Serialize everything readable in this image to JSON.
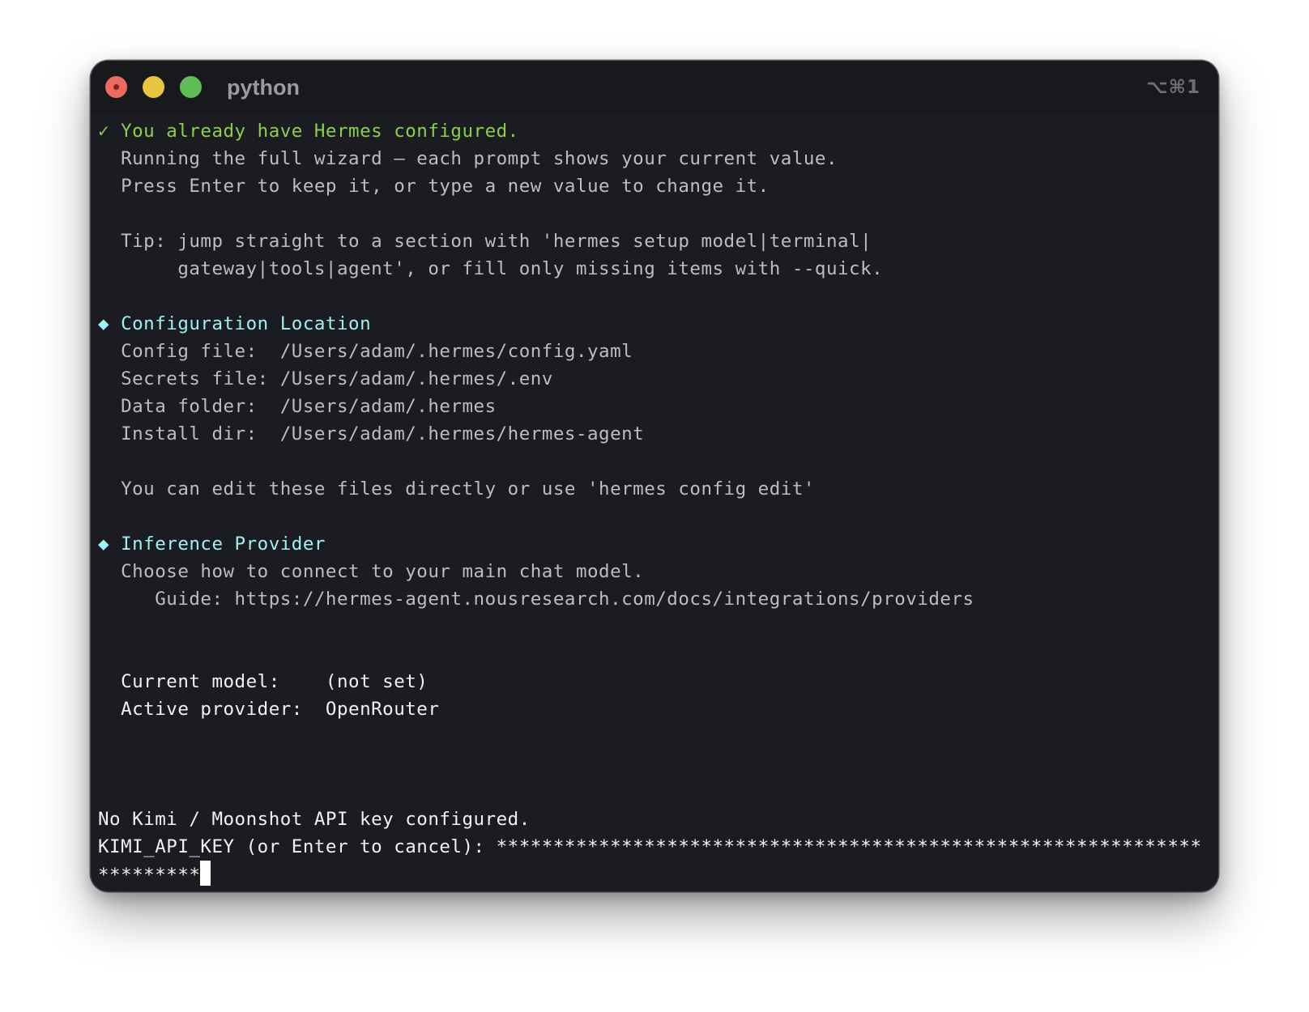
{
  "window": {
    "title": "python",
    "shortcut": "⌥⌘1"
  },
  "terminal": {
    "configured_mark": "✓",
    "configured_text": "You already have Hermes configured.",
    "wizard_line1": "Running the full wizard — each prompt shows your current value.",
    "wizard_line2": "Press Enter to keep it, or type a new value to change it.",
    "tip_line1": "Tip: jump straight to a section with 'hermes setup model|terminal|",
    "tip_line2": "gateway|tools|agent', or fill only missing items with --quick.",
    "section_marker": "◆",
    "config_heading": "Configuration Location",
    "config_file": "Config file:  /Users/adam/.hermes/config.yaml",
    "secrets_file": "Secrets file: /Users/adam/.hermes/.env",
    "data_folder": "Data folder:  /Users/adam/.hermes",
    "install_dir": "Install dir:  /Users/adam/.hermes/hermes-agent",
    "edit_hint": "You can edit these files directly or use 'hermes config edit'",
    "provider_heading": "Inference Provider",
    "provider_desc": "Choose how to connect to your main chat model.",
    "guide_line": "Guide: https://hermes-agent.nousresearch.com/docs/integrations/providers",
    "current_model": "Current model:    (not set)",
    "active_provider": "Active provider:  OpenRouter",
    "no_key": "No Kimi / Moonshot API key configured.",
    "prompt_label": "KIMI_API_KEY (or Enter to cancel): ",
    "masked_input_line1": "**************************************************************",
    "masked_input_line2": "*********"
  }
}
